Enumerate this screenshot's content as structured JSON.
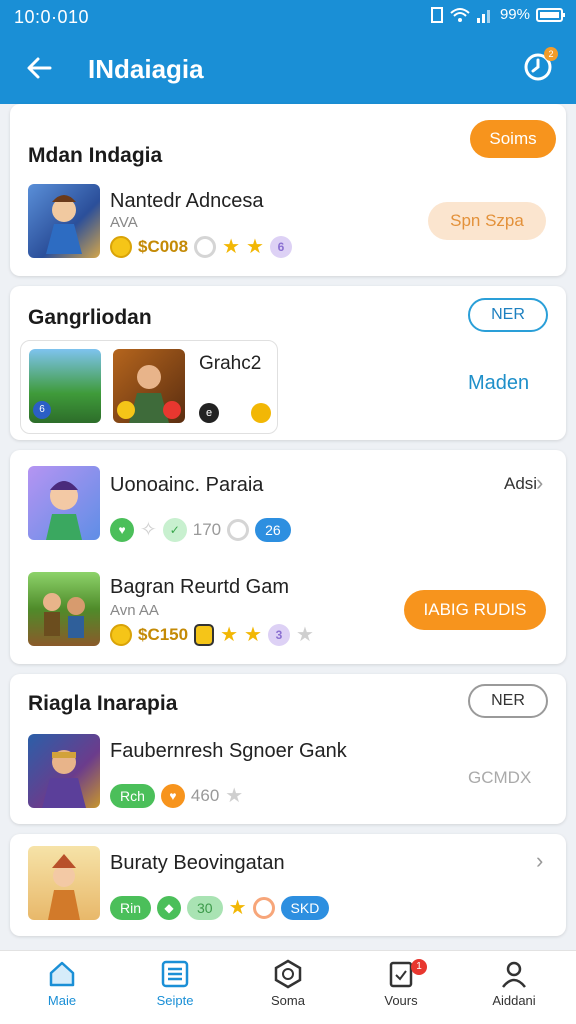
{
  "status_bar": {
    "time": "10:0·010",
    "battery": "99%"
  },
  "app_bar": {
    "title": "INdaiagia",
    "notification_count": "2"
  },
  "section1": {
    "title": "Mdan Indagia",
    "corner_button": "Soims",
    "item": {
      "title": "Nantedr Adncesa",
      "subtitle": "AVA",
      "price": "$C008",
      "action": "Spn Szpa"
    }
  },
  "section2": {
    "title": "Gangrliodan",
    "tag_button": "NER",
    "group_label": "Grahc2",
    "side_link": "Maden"
  },
  "section3": {
    "item1": {
      "title": "Uonoainc. Paraia",
      "side": "Adsi",
      "count": "170",
      "badge": "26"
    },
    "item2": {
      "title": "Bagran Reurtd Gam",
      "subtitle": "Avn AA",
      "price": "$C150",
      "action": "IABIG RUDIS"
    }
  },
  "section4": {
    "title": "Riagla Inarapia",
    "tag_button": "NER",
    "item": {
      "title": "Faubernresh Sgnoer Gank",
      "pill": "Rch",
      "count": "460",
      "side": "GCMDX"
    }
  },
  "section5": {
    "item": {
      "title": "Buraty Beovingatan",
      "pill1": "Rin",
      "pill2": "30",
      "pill3": "SKD"
    }
  },
  "bottom_nav": {
    "items": [
      {
        "label": "Maie"
      },
      {
        "label": "Seipte"
      },
      {
        "label": "Soma"
      },
      {
        "label": "Vours",
        "badge": "1"
      },
      {
        "label": "Aiddani"
      }
    ]
  },
  "colors": {
    "primary": "#1a8fd6",
    "accent": "#f7941d"
  }
}
